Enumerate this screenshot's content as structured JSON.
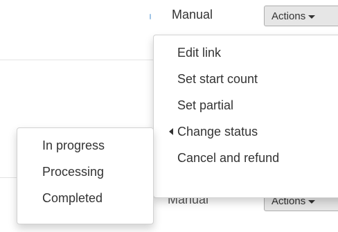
{
  "rows": [
    {
      "mode": "Manual",
      "actions_label": "Actions"
    },
    {
      "mode": "Manual",
      "actions_label": "Actions"
    }
  ],
  "actions_menu": {
    "items": [
      {
        "label": "Edit link"
      },
      {
        "label": "Set start count"
      },
      {
        "label": "Set partial"
      },
      {
        "label": "Change status",
        "has_submenu": true
      },
      {
        "label": "Cancel and refund"
      }
    ]
  },
  "status_submenu": {
    "items": [
      {
        "label": "In progress"
      },
      {
        "label": "Processing"
      },
      {
        "label": "Completed"
      }
    ]
  },
  "colors": {
    "button_bg": "#e6e6e6",
    "button_border": "#adadad",
    "text": "#333333"
  },
  "icons": {
    "actions_caret": "caret-down-icon",
    "submenu_caret": "caret-left-icon"
  }
}
